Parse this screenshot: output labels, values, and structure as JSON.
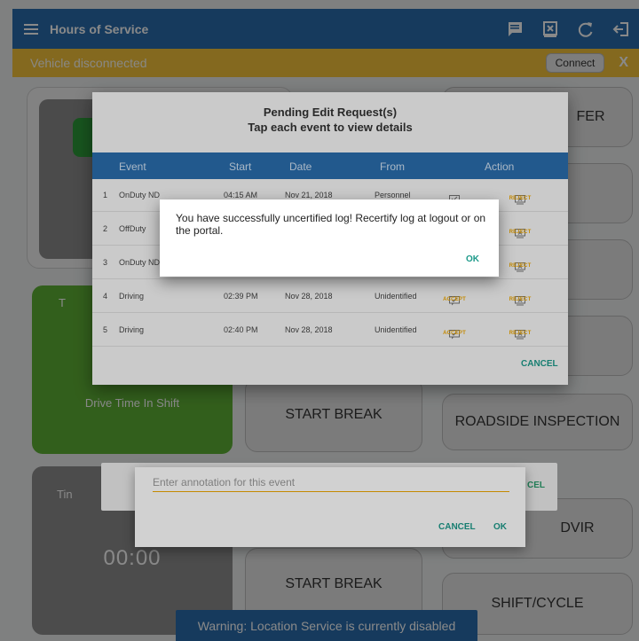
{
  "appbar": {
    "title": "Hours of Service"
  },
  "banner": {
    "message": "Vehicle disconnected",
    "connect_label": "Connect",
    "close_label": "X"
  },
  "tiles": {
    "transfer_partial": "FER",
    "drive_time_label": "Drive Time In Shift",
    "drive_partial": "T",
    "start_break_1": "START BREAK",
    "roadside_inspection": "ROADSIDE INSPECTION",
    "time_partial": "Tin",
    "timer_value": "00:00",
    "start_break_2": "START BREAK",
    "dvir_partial": "DVIR",
    "shift_cycle": "SHIFT/CYCLE"
  },
  "warning": "Warning: Location Service is currently disabled",
  "annotation_dialog": {
    "placeholder": "Enter annotation for this event",
    "cancel_label": "CANCEL",
    "ok_label": "OK",
    "ghost_cancel": "CEL"
  },
  "pending_dialog": {
    "title_line1": "Pending Edit Request(s)",
    "title_line2": "Tap each event to view details",
    "columns": {
      "event": "Event",
      "start": "Start",
      "date": "Date",
      "from": "From",
      "action": "Action"
    },
    "accept_label": "ACCEPT",
    "reject_label": "REJECT",
    "cancel_label": "CANCEL",
    "rows": [
      {
        "num": "1",
        "event": "OnDuty ND",
        "start": "04:15 AM",
        "date": "Nov 21, 2018",
        "from": "Personnel"
      },
      {
        "num": "2",
        "event": "OffDuty",
        "start": "",
        "date": "",
        "from": ""
      },
      {
        "num": "3",
        "event": "OnDuty ND",
        "start": "",
        "date": "",
        "from": ""
      },
      {
        "num": "4",
        "event": "Driving",
        "start": "02:39 PM",
        "date": "Nov 28, 2018",
        "from": "Unidentified"
      },
      {
        "num": "5",
        "event": "Driving",
        "start": "02:40 PM",
        "date": "Nov 28, 2018",
        "from": "Unidentified"
      }
    ]
  },
  "success_dialog": {
    "message": "You have successfully uncertified log! Recertify log at logout or on the portal.",
    "ok_label": "OK"
  }
}
